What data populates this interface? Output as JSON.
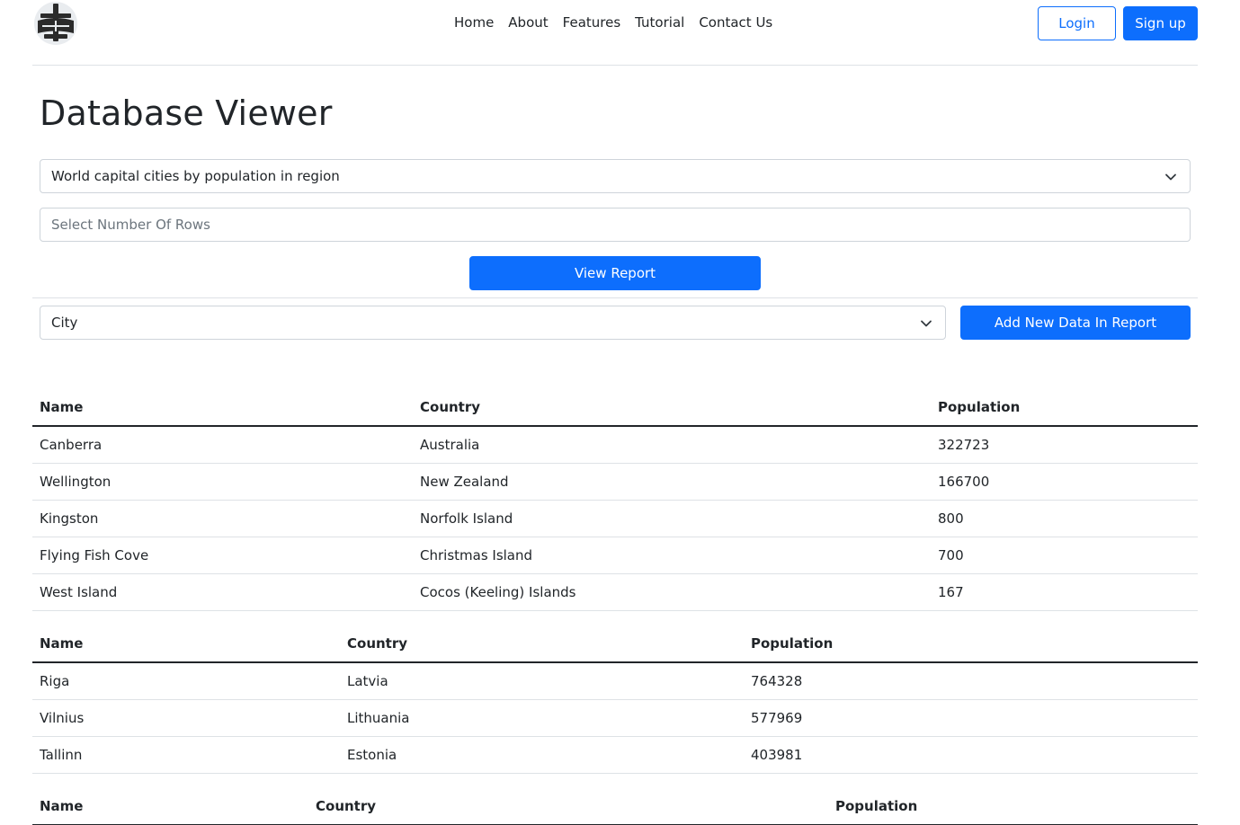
{
  "header": {
    "nav": [
      "Home",
      "About",
      "Features",
      "Tutorial",
      "Contact Us"
    ],
    "login_label": "Login",
    "signup_label": "Sign up"
  },
  "main": {
    "title": "Database Viewer",
    "report_select_value": "World capital cities by population in region",
    "rows_placeholder": "Select Number Of Rows",
    "view_report_label": "View Report",
    "table_select_value": "City",
    "add_data_label": "Add New Data In Report"
  },
  "tables": [
    {
      "headers": [
        "Name",
        "Country",
        "Population"
      ],
      "rows": [
        [
          "Canberra",
          "Australia",
          "322723"
        ],
        [
          "Wellington",
          "New Zealand",
          "166700"
        ],
        [
          "Kingston",
          "Norfolk Island",
          "800"
        ],
        [
          "Flying Fish Cove",
          "Christmas Island",
          "700"
        ],
        [
          "West Island",
          "Cocos (Keeling) Islands",
          "167"
        ]
      ]
    },
    {
      "headers": [
        "Name",
        "Country",
        "Population"
      ],
      "rows": [
        [
          "Riga",
          "Latvia",
          "764328"
        ],
        [
          "Vilnius",
          "Lithuania",
          "577969"
        ],
        [
          "Tallinn",
          "Estonia",
          "403981"
        ]
      ]
    },
    {
      "headers": [
        "Name",
        "Country",
        "Population"
      ],
      "rows": []
    }
  ],
  "colors": {
    "primary": "#0d6efd",
    "text": "#212529",
    "border": "#dee2e6"
  }
}
